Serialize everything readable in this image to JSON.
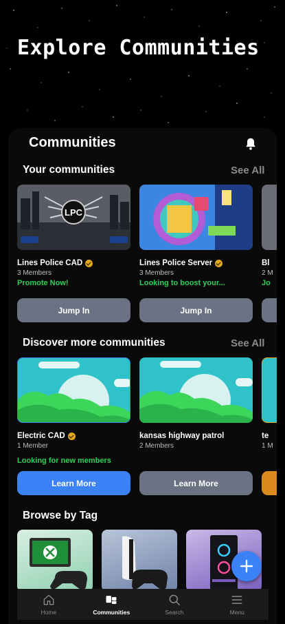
{
  "hero": {
    "title": "Explore Communities"
  },
  "header": {
    "title": "Communities"
  },
  "your_communities": {
    "title": "Your communities",
    "see_all": "See All",
    "cards": [
      {
        "name": "Lines Police CAD",
        "members": "3 Members",
        "status": "Promote Now!",
        "button": "Jump In",
        "logo_text": "LPC"
      },
      {
        "name": "Lines Police Server",
        "members": "3 Members",
        "status": "Looking to boost your...",
        "button": "Jump In"
      },
      {
        "name": "Bl",
        "members": "2 M",
        "status": "Jo",
        "button": ""
      }
    ]
  },
  "discover": {
    "title": "Discover more communities",
    "see_all": "See All",
    "cards": [
      {
        "name": "Electric CAD",
        "members": "1 Member",
        "status": "Looking for new members",
        "button": "Learn More"
      },
      {
        "name": "kansas highway patrol",
        "members": "2 Members",
        "status": "",
        "button": "Learn More"
      },
      {
        "name": "te",
        "members": "1 M",
        "status": "",
        "button": ""
      }
    ]
  },
  "browse": {
    "title": "Browse by Tag"
  },
  "nav": {
    "items": [
      {
        "label": "Home",
        "icon": "home-icon"
      },
      {
        "label": "Communities",
        "icon": "communities-icon"
      },
      {
        "label": "Search",
        "icon": "search-icon"
      },
      {
        "label": "Menu",
        "icon": "menu-icon"
      }
    ],
    "active": "Communities"
  },
  "colors": {
    "accent": "#3b82f6",
    "button_gray": "#6b7284",
    "status_green": "#2fcf57",
    "verified_gold": "#e3a81b"
  }
}
